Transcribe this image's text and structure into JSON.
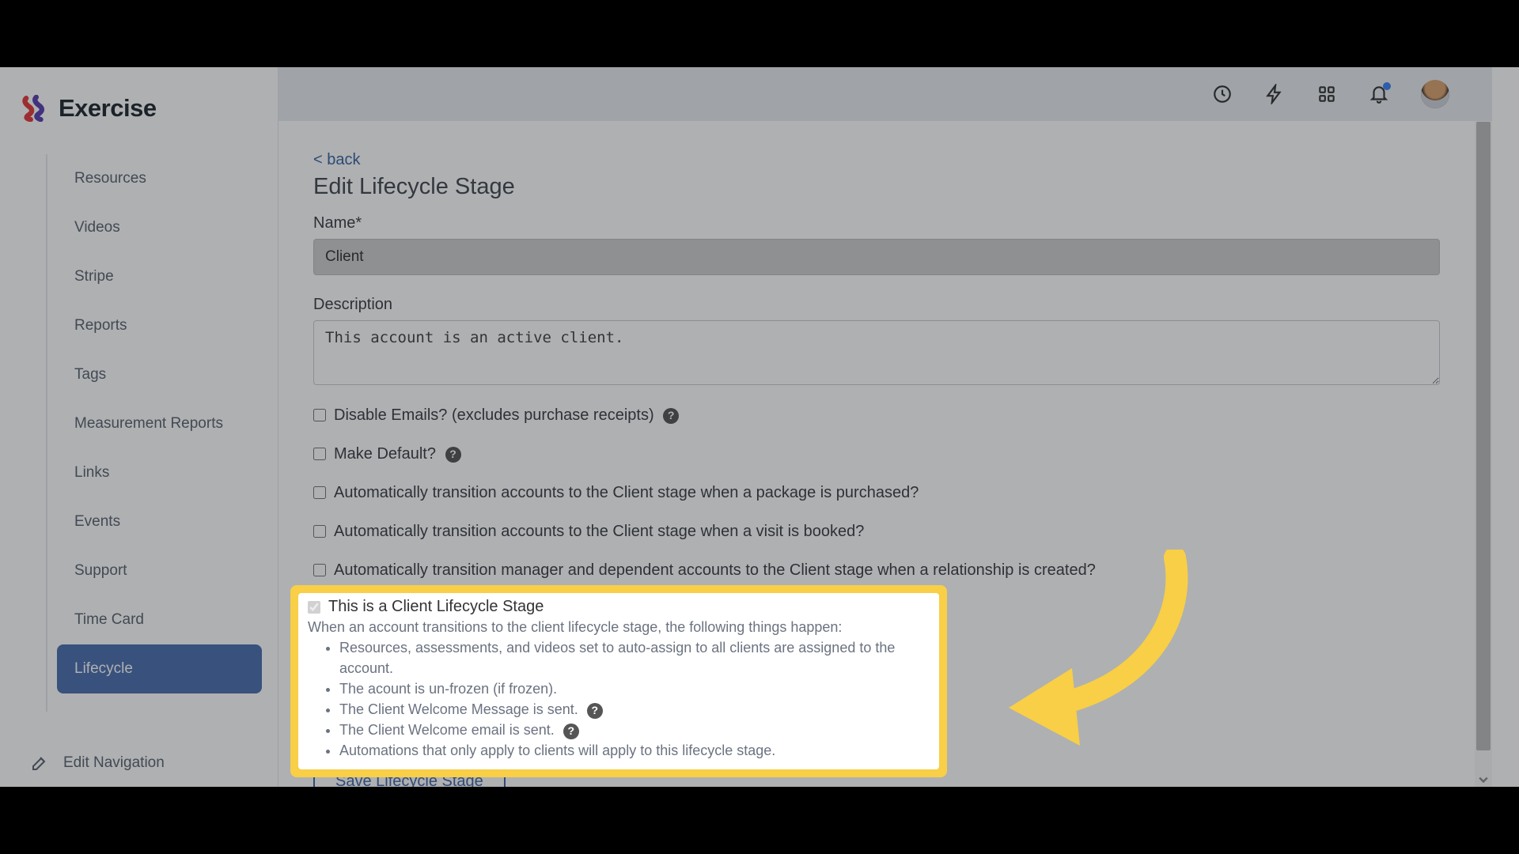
{
  "brand": {
    "name": "Exercise"
  },
  "sidebar": {
    "items": [
      {
        "label": "Resources"
      },
      {
        "label": "Videos"
      },
      {
        "label": "Stripe"
      },
      {
        "label": "Reports"
      },
      {
        "label": "Tags"
      },
      {
        "label": "Measurement Reports"
      },
      {
        "label": "Links"
      },
      {
        "label": "Events"
      },
      {
        "label": "Support"
      },
      {
        "label": "Time Card"
      },
      {
        "label": "Lifecycle"
      }
    ],
    "edit_nav": "Edit Navigation"
  },
  "page": {
    "back": "< back",
    "title": "Edit Lifecycle Stage",
    "name_label": "Name*",
    "name_value": "Client",
    "desc_label": "Description",
    "desc_value": "This account is an active client.",
    "checkboxes": {
      "disable_emails": "Disable Emails? (excludes purchase receipts)",
      "make_default": "Make Default?",
      "auto_package": "Automatically transition accounts to the Client stage when a package is purchased?",
      "auto_visit": "Automatically transition accounts to the Client stage when a visit is booked?",
      "auto_relationship": "Automatically transition manager and dependent accounts to the Client stage when a relationship is created?"
    },
    "highlight": {
      "title": "This is a Client Lifecycle Stage",
      "lead": "When an account transitions to the client lifecycle stage, the following things happen:",
      "bullets": [
        "Resources, assessments, and videos set to auto-assign to all clients are assigned to the account.",
        "The acount is un-frozen (if frozen).",
        "The Client Welcome Message is sent.",
        "The Client Welcome email is sent.",
        "Automations that only apply to clients will apply to this lifecycle stage."
      ]
    },
    "save": "Save Lifecycle Stage"
  }
}
